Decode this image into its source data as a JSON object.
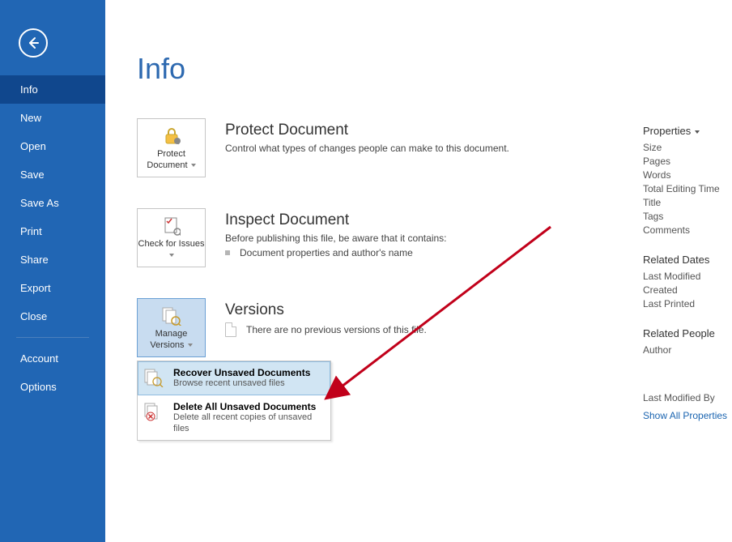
{
  "sidebar": {
    "items": [
      {
        "label": "Info",
        "selected": true
      },
      {
        "label": "New"
      },
      {
        "label": "Open"
      },
      {
        "label": "Save"
      },
      {
        "label": "Save As"
      },
      {
        "label": "Print"
      },
      {
        "label": "Share"
      },
      {
        "label": "Export"
      },
      {
        "label": "Close"
      }
    ],
    "lower": [
      {
        "label": "Account"
      },
      {
        "label": "Options"
      }
    ]
  },
  "page": {
    "title": "Info"
  },
  "protect": {
    "tile": "Protect Document",
    "heading": "Protect Document",
    "desc": "Control what types of changes people can make to this document."
  },
  "inspect": {
    "tile": "Check for Issues",
    "heading": "Inspect Document",
    "lead": "Before publishing this file, be aware that it contains:",
    "bullet": "Document properties and author's name"
  },
  "versions": {
    "tile": "Manage Versions",
    "heading": "Versions",
    "desc": "There are no previous versions of this file.",
    "menu": [
      {
        "title": "Recover Unsaved Documents",
        "desc": "Browse recent unsaved files"
      },
      {
        "title": "Delete All Unsaved Documents",
        "desc": "Delete all recent copies of unsaved files"
      }
    ]
  },
  "right": {
    "props_heading": "Properties",
    "props": [
      "Size",
      "Pages",
      "Words",
      "Total Editing Time",
      "Title",
      "Tags",
      "Comments"
    ],
    "dates_heading": "Related Dates",
    "dates": [
      "Last Modified",
      "Created",
      "Last Printed"
    ],
    "people_heading": "Related People",
    "people": [
      "Author"
    ],
    "last_mod_by": "Last Modified By",
    "show_all": "Show All Properties"
  }
}
